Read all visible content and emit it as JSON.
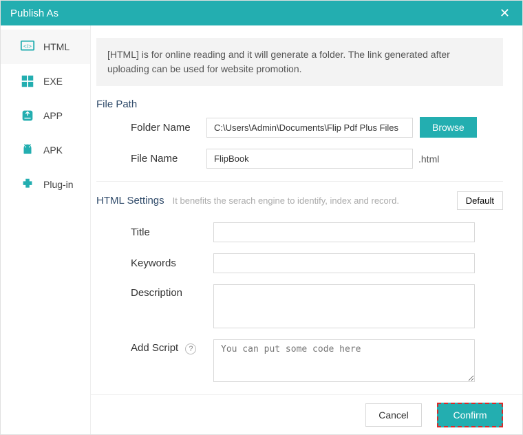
{
  "titlebar": {
    "title": "Publish As"
  },
  "sidebar": {
    "items": [
      {
        "label": "HTML"
      },
      {
        "label": "EXE"
      },
      {
        "label": "APP"
      },
      {
        "label": "APK"
      },
      {
        "label": "Plug-in"
      }
    ]
  },
  "info": "[HTML] is for online reading and it will generate a folder. The link generated after uploading can be used for website promotion.",
  "filepath": {
    "section_label": "File Path",
    "folder_label": "Folder Name",
    "folder_value": "C:\\Users\\Admin\\Documents\\Flip Pdf Plus Files",
    "browse_label": "Browse",
    "file_label": "File Name",
    "file_value": "FlipBook",
    "file_ext": ".html"
  },
  "settings": {
    "section_label": "HTML Settings",
    "hint": "It benefits the serach engine to identify, index and record.",
    "default_label": "Default",
    "title_label": "Title",
    "title_value": "",
    "keywords_label": "Keywords",
    "keywords_value": "",
    "description_label": "Description",
    "description_value": "",
    "script_label": "Add Script",
    "script_placeholder": "You can put some code here",
    "script_value": ""
  },
  "footer": {
    "cancel_label": "Cancel",
    "confirm_label": "Confirm"
  }
}
